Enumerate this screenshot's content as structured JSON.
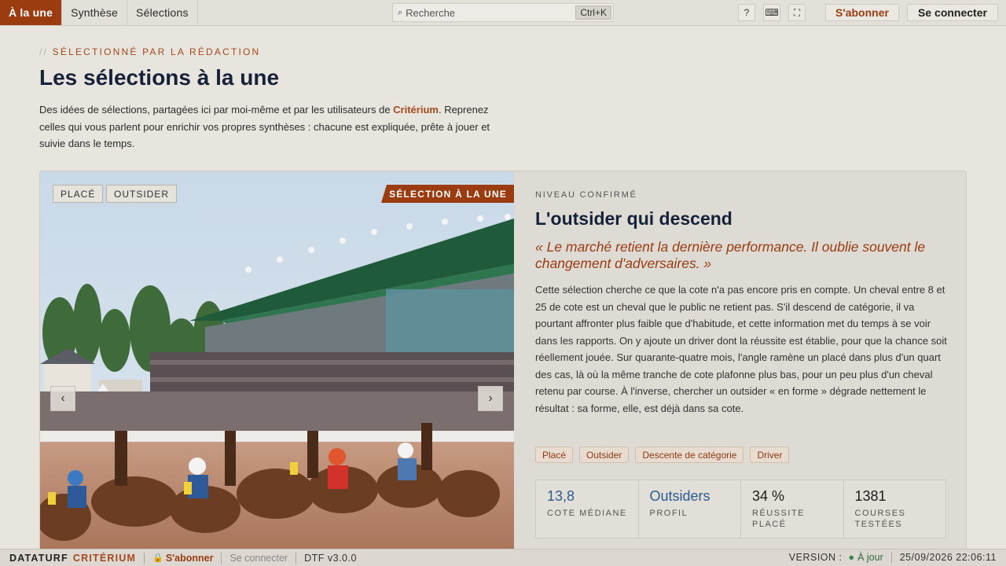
{
  "nav": {
    "tabs": [
      {
        "label": "À la une"
      },
      {
        "label": "Synthèse"
      },
      {
        "label": "Sélections"
      }
    ],
    "search": {
      "placeholder": "Recherche",
      "shortcut": "Ctrl+K"
    },
    "icons": {
      "help": "?",
      "keyboard": "⌨",
      "fullscreen": "⛶"
    },
    "subscribe_label": "S'abonner",
    "login_label": "Se connecter"
  },
  "header": {
    "eyebrow_slashes": "//",
    "eyebrow": "SÉLECTIONNÉ PAR LA RÉDACTION",
    "title": "Les sélections à la une",
    "intro_before": "Des idées de sélections, partagées ici par moi-même et par les utilisateurs de ",
    "intro_brand": "Critérium",
    "intro_after": ". Reprenez celles qui vous parlent pour enrichir vos propres synthèses : chacune est expliquée, prête à jouer et suivie dans le temps."
  },
  "feature": {
    "chips": [
      "PLACÉ",
      "OUTSIDER"
    ],
    "badge": "SÉLECTION À LA UNE",
    "prev": "‹",
    "next": "›",
    "level": "NIVEAU CONFIRMÉ",
    "title": "L'outsider qui descend",
    "quote": "« Le marché retient la dernière performance. Il oublie souvent le changement d'adversaires. »",
    "description": "Cette sélection cherche ce que la cote n'a pas encore pris en compte. Un cheval entre 8 et 25 de cote est un cheval que le public ne retient pas. S'il descend de catégorie, il va pourtant affronter plus faible que d'habitude, et cette information met du temps à se voir dans les rapports. On y ajoute un driver dont la réussite est établie, pour que la chance soit réellement jouée. Sur quarante-quatre mois, l'angle ramène un placé dans plus d'un quart des cas, là où la même tranche de cote plafonne plus bas, pour un peu plus d'un cheval retenu par course. À l'inverse, chercher un outsider « en forme » dégrade nettement le résultat : sa forme, elle, est déjà dans sa cote.",
    "tags": [
      "Placé",
      "Outsider",
      "Descente de catégorie",
      "Driver"
    ],
    "stats": [
      {
        "value": "13,8",
        "label": "COTE MÉDIANE"
      },
      {
        "value": "Outsiders",
        "label": "PROFIL"
      },
      {
        "value": "34 %",
        "label": "RÉUSSITE PLACÉ"
      },
      {
        "value": "1381",
        "label": "COURSES TESTÉES"
      }
    ]
  },
  "status": {
    "brand": "DATATURF",
    "brand2": "CRITÉRIUM",
    "subscribe": "S'abonner",
    "login": "Se connecter",
    "version_code": "DTF v3.0.0",
    "version_label": "VERSION :",
    "version_state": "À jour",
    "datetime": "25/09/2026 22:06:11"
  },
  "colors": {
    "accent": "#9a3b10",
    "background": "#e8e5df",
    "title": "#16213a",
    "stat_blue": "#2b5d8f"
  }
}
